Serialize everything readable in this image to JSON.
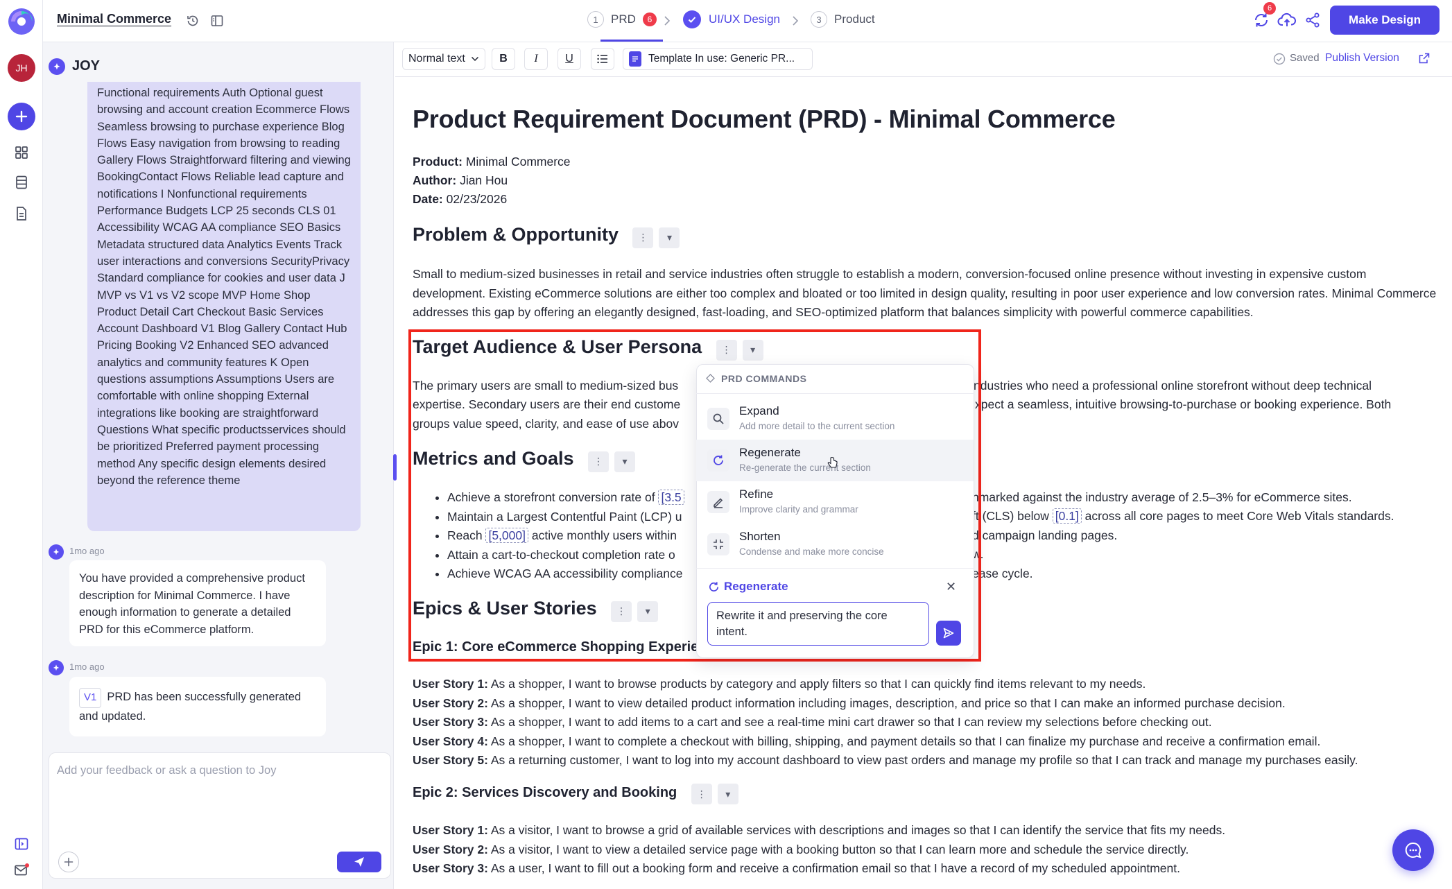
{
  "app": {
    "title": "Minimal Commerce",
    "make_design": "Make Design",
    "sync_badge": "6",
    "user_initials": "JH"
  },
  "steps": [
    {
      "num": "1",
      "label": "PRD",
      "badge": "6"
    },
    {
      "num": "",
      "label": "UI/UX Design"
    },
    {
      "num": "3",
      "label": "Product"
    }
  ],
  "chat": {
    "title": "JOY",
    "user_message": "Functional requirements Auth Optional guest browsing and account creation Ecommerce Flows Seamless browsing to purchase experience Blog Flows Easy navigation from browsing to reading Gallery Flows Straightforward filtering and viewing BookingContact Flows Reliable lead capture and notifications I Nonfunctional requirements Performance Budgets LCP 25 seconds CLS 01 Accessibility WCAG AA compliance SEO Basics Metadata structured data Analytics Events Track user interactions and conversions SecurityPrivacy Standard compliance for cookies and user data J MVP vs V1 vs V2 scope MVP Home Shop Product Detail Cart Checkout Basic Services Account Dashboard V1 Blog Gallery Contact Hub Pricing Booking V2 Enhanced SEO advanced analytics and community features K Open questions assumptions Assumptions Users are comfortable with online shopping External integrations like booking are straightforward Questions What specific productsservices should be prioritized Preferred payment processing method Any specific design elements desired beyond the reference theme",
    "msg1_time": "1mo ago",
    "msg1_text": "You have provided a comprehensive product description for Minimal Commerce. I have enough information to generate a detailed PRD for this eCommerce platform.",
    "msg2_time": "1mo ago",
    "msg2_version": "V1",
    "msg2_text": "PRD has been successfully generated and updated.",
    "input_placeholder": "Add your feedback or ask a question to Joy"
  },
  "toolbar": {
    "text_style": "Normal text",
    "bold": "B",
    "italic": "I",
    "underline": "U",
    "template": "Template In use: Generic PR...",
    "saved": "Saved",
    "publish": "Publish Version"
  },
  "doc": {
    "title": "Product Requirement Document (PRD) - Minimal Commerce",
    "product_label": "Product:",
    "product": "Minimal Commerce",
    "author_label": "Author:",
    "author": "Jian Hou",
    "date_label": "Date:",
    "date": "02/23/2026",
    "problem_heading": "Problem & Opportunity",
    "problem_text": "Small to medium-sized businesses in retail and service industries often struggle to establish a modern, conversion-focused online presence without investing in expensive custom development. Existing eCommerce solutions are either too complex and bloated or too limited in design quality, resulting in poor user experience and low conversion rates. Minimal Commerce addresses this gap by offering an elegantly designed, fast-loading, and SEO-optimized platform that balances simplicity with powerful commerce capabilities.",
    "audience_heading": "Target Audience & User Persona",
    "audience_l1a": "The primary users are small to medium-sized bus",
    "audience_l1b": "ndustries who need a professional online storefront without deep technical",
    "audience_l2a": "expertise. Secondary users are their end custome",
    "audience_l2b": "xpect a seamless, intuitive browsing-to-purchase or booking experience. Both",
    "audience_l3a": "groups value speed, clarity, and ease of use abov",
    "metrics_heading": "Metrics and Goals",
    "m1a": "Achieve a storefront conversion rate of ",
    "m1tag": "[3.5",
    "m1b": "nmarked against the industry average of 2.5–3% for eCommerce sites.",
    "m2a": "Maintain a Largest Contentful Paint (LCP) u",
    "m2b": "ft (CLS) below ",
    "m2tag": "[0.1]",
    "m2c": " across all core pages to meet Core Web Vitals standards.",
    "m3a": "Reach ",
    "m3tag": "[5,000]",
    "m3b": " active monthly users within ",
    "m3c": "d campaign landing pages.",
    "m4a": "Attain a cart-to-checkout completion rate o",
    "m4b": "w.",
    "m5a": "Achieve WCAG AA accessibility compliance",
    "m5b": "ease cycle.",
    "epics_heading": "Epics & User Stories",
    "epic1_heading": "Epic 1: Core eCommerce Shopping Experie",
    "epic1_stories": [
      {
        "label": "User Story 1:",
        "text": " As a shopper, I want to browse products by category and apply filters so that I can quickly find items relevant to my needs."
      },
      {
        "label": "User Story 2:",
        "text": " As a shopper, I want to view detailed product information including images, description, and price so that I can make an informed purchase decision."
      },
      {
        "label": "User Story 3:",
        "text": " As a shopper, I want to add items to a cart and see a real-time mini cart drawer so that I can review my selections before checking out."
      },
      {
        "label": "User Story 4:",
        "text": " As a shopper, I want to complete a checkout with billing, shipping, and payment details so that I can finalize my purchase and receive a confirmation email."
      },
      {
        "label": "User Story 5:",
        "text": " As a returning customer, I want to log into my account dashboard to view past orders and manage my profile so that I can track and manage my purchases easily."
      }
    ],
    "epic2_heading": "Epic 2: Services Discovery and Booking",
    "epic2_stories": [
      {
        "label": "User Story 1:",
        "text": " As a visitor, I want to browse a grid of available services with descriptions and images so that I can identify the service that fits my needs."
      },
      {
        "label": "User Story 2:",
        "text": " As a visitor, I want to view a detailed service page with a booking button so that I can learn more and schedule the service directly."
      },
      {
        "label": "User Story 3:",
        "text": " As a user, I want to fill out a booking form and receive a confirmation email so that I have a record of my scheduled appointment."
      }
    ]
  },
  "popup": {
    "header": "PRD COMMANDS",
    "commands": [
      {
        "title": "Expand",
        "sub": "Add more detail to the current section",
        "icon": "search-icon"
      },
      {
        "title": "Regenerate",
        "sub": "Re-generate the current section",
        "icon": "refresh-icon"
      },
      {
        "title": "Refine",
        "sub": "Improve clarity and grammar",
        "icon": "pencil-icon"
      },
      {
        "title": "Shorten",
        "sub": "Condense and make more concise",
        "icon": "collapse-icon"
      }
    ],
    "active_label": "Regenerate",
    "input_value": "Rewrite it and preserving the core intent."
  },
  "colors": {
    "accent": "#4f46e5",
    "highlight": "#f0251b",
    "badge": "#ef3b4a",
    "user_bubble": "#dcdaf7"
  }
}
